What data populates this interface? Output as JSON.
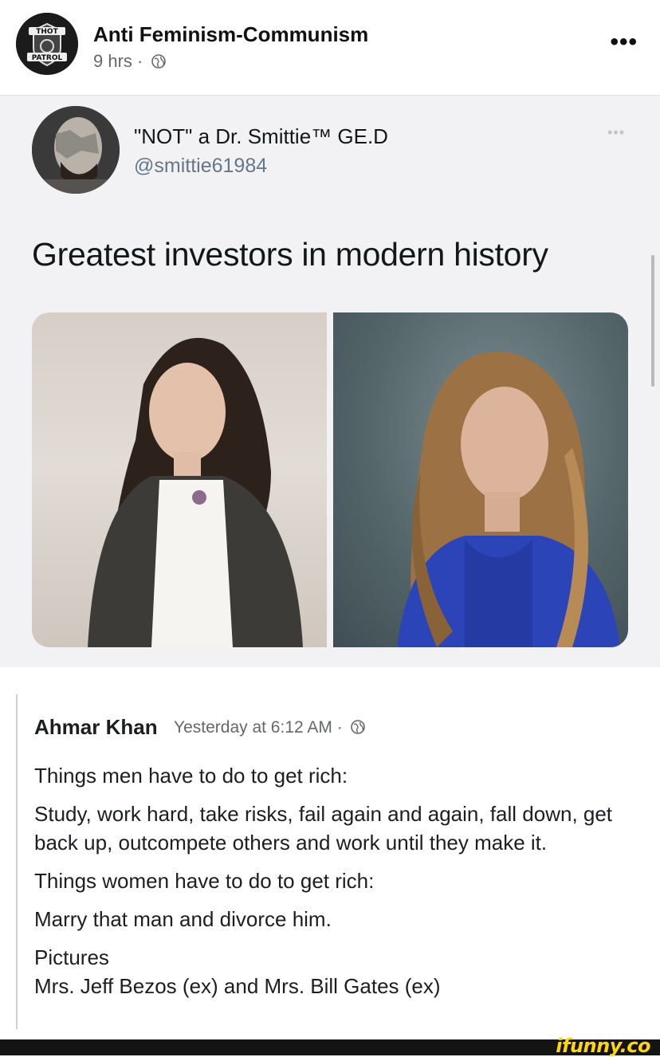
{
  "post": {
    "page_name": "Anti Feminism-Communism",
    "time": "9 hrs",
    "separator": "·",
    "more_label": "•••",
    "avatar_top_text": "THOT",
    "avatar_bottom_text": "PATROL"
  },
  "tweet": {
    "display_name": "\"NOT\" a Dr. Smittie™ GE.D",
    "handle": "@smittie61984",
    "more_label": "•••",
    "text": "Greatest investors in modern history"
  },
  "comment": {
    "author": "Ahmar Khan",
    "time": "Yesterday at 6:12 AM ·",
    "lines": [
      "Things men have to do to get rich:",
      "Study, work hard, take risks, fail again and again, fall down, get back up, outcompete others and work until they make it.",
      "Things women have to do to get rich:",
      "Marry that man and divorce him."
    ],
    "pictures_label": "Pictures",
    "pictures_caption": "Mrs. Jeff Bezos (ex) and Mrs. Bill Gates (ex)"
  },
  "watermark": "ifunny.co",
  "colors": {
    "meta_gray": "#65676b",
    "tweet_bg": "#f2f2f4",
    "ifunny_yellow": "#ffd60a"
  }
}
